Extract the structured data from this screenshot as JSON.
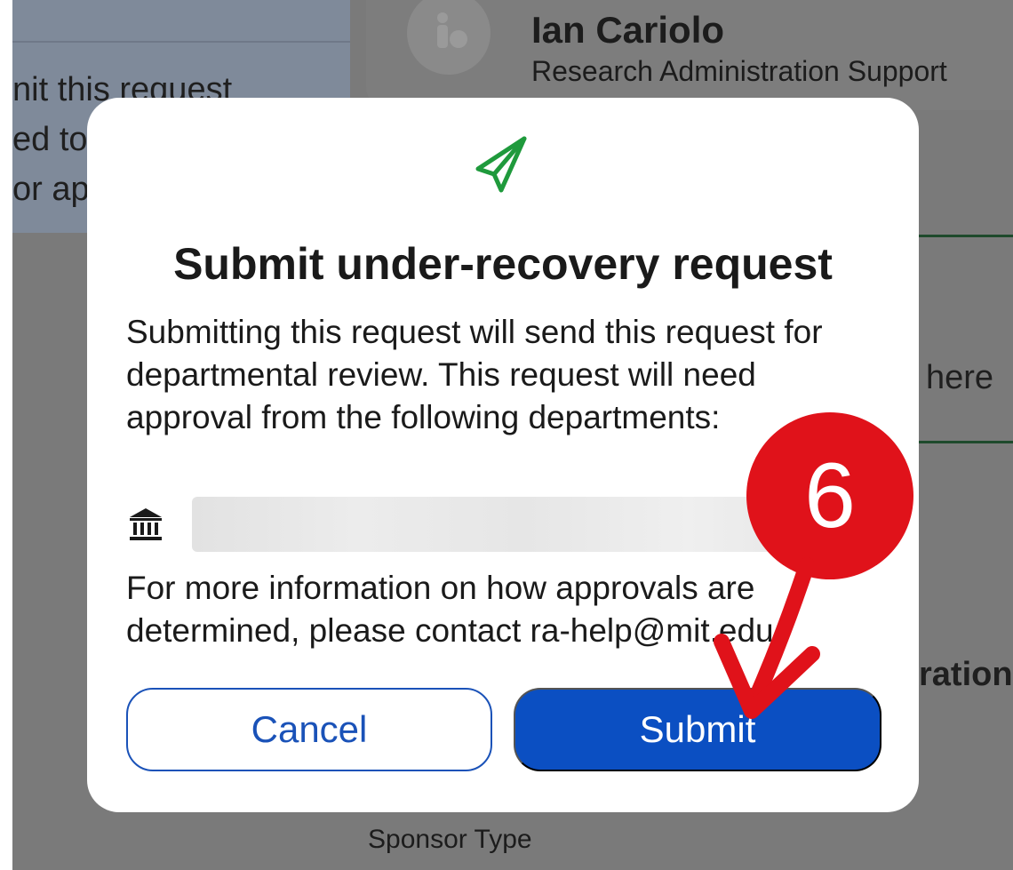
{
  "background": {
    "left_panel_lines": [
      "nit this request",
      "ed to",
      "or ap"
    ],
    "contact_name": "Ian Cariolo",
    "contact_role": "Research Administration Support",
    "right_fragment_1": "here",
    "right_fragment_2": "ration",
    "sponsor_type_label": "Sponsor Type"
  },
  "modal": {
    "icon": "paper-plane-icon",
    "title": "Submit under-recovery request",
    "body": "Submitting this request will send this request for departmental review. This request will need approval from the following departments:",
    "department_icon": "institution-icon",
    "department_name": "",
    "info_text": "For more information on how approvals are determined, please contact ra-help@mit.edu",
    "cancel_label": "Cancel",
    "submit_label": "Submit"
  },
  "annotation": {
    "step_number": "6"
  },
  "colors": {
    "accent_green": "#1f9a3c",
    "primary_blue": "#0b4fc2",
    "annotation_red": "#e0121a"
  }
}
